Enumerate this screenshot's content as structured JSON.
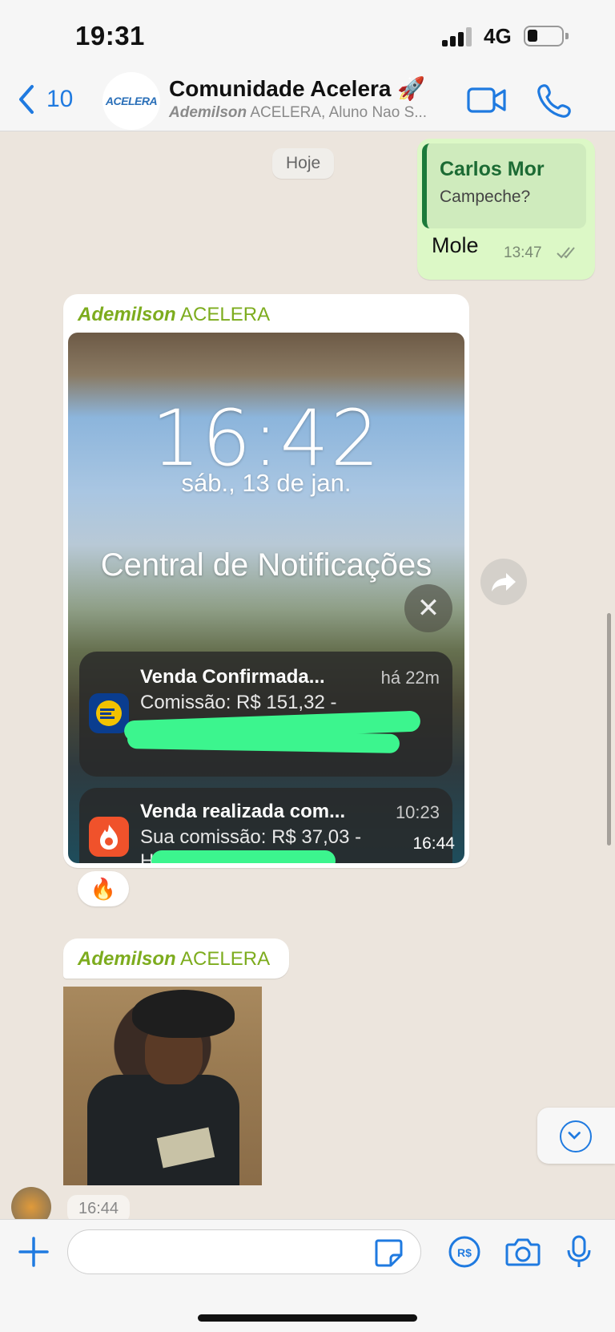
{
  "status_bar": {
    "time": "19:31",
    "network": "4G"
  },
  "header": {
    "back_count": "10",
    "avatar_text": "ACELERA",
    "title": "Comunidade Acelera 🚀",
    "subtitle_name": "Ademilson",
    "subtitle_rest": " ACELERA, Aluno Nao S..."
  },
  "chat": {
    "date_label": "Hoje",
    "outgoing": {
      "reply_name": "Carlos Mor",
      "reply_text": "Campeche?",
      "text": "Mole",
      "time": "13:47"
    },
    "image_message": {
      "sender_name": "Ademilson",
      "sender_tag": "ACELERA",
      "lock_time": "16:42",
      "lock_date": "sáb., 13 de jan.",
      "notification_center": "Central de Notificações",
      "notifications": [
        {
          "title": "Venda Confirmada...",
          "time": "há 22m",
          "body": "Comissão: R$ 151,32 -"
        },
        {
          "title": "Venda realizada com...",
          "time": "10:23",
          "body": "Sua comissão: R$ 37,03 -",
          "body2": "HP"
        }
      ],
      "time": "16:44",
      "reaction": "🔥"
    },
    "sticker_message": {
      "sender_name": "Ademilson",
      "sender_tag": "ACELERA",
      "time": "16:44"
    }
  },
  "input": {
    "placeholder": ""
  },
  "colors": {
    "accent": "#1f7ae0",
    "outgoing_bubble": "#dcf8c6",
    "sender_name": "#7dac1e",
    "background": "#ece5dd"
  }
}
